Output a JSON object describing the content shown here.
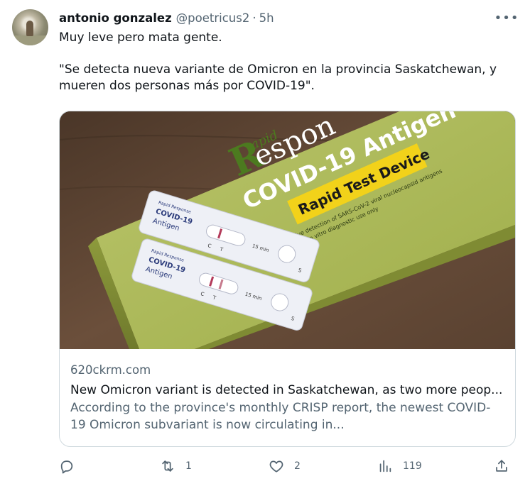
{
  "tweet": {
    "author_name": "antonio gonzalez",
    "handle": "@poetricus2",
    "separator": "·",
    "time": "5h",
    "more_label": "•••",
    "text_line1": "Muy leve pero mata gente.",
    "text_line2": "\"Se detecta nueva variante de Omicron en la provincia Saskatchewan, y mueren dos personas más por COVID-19\"."
  },
  "card": {
    "image_text": {
      "brand_r": "R",
      "brand_apid": "apid",
      "brand_respon": "espon",
      "antigen": "COVID-19 Antigen",
      "device": "Rapid Test Device",
      "fine_print_1": "Qualitative detection of SARS-CoV-2 viral nucleocapsid antigens",
      "fine_print_2": "For in vitro diagnostic use only",
      "cassette_brand": "Rapid Response",
      "cassette_label_1": "COVID-19",
      "cassette_label_2": "Antigen",
      "cassette_c": "C",
      "cassette_t": "T",
      "cassette_time": "15 min",
      "cassette_s": "S"
    },
    "domain": "620ckrm.com",
    "title": "New Omicron variant is detected in Saskatchewan, as two more peop...",
    "description": "According to the province's monthly CRISP report, the newest COVID-19 Omicron subvariant is now circulating in..."
  },
  "actions": {
    "reply_count": "",
    "retweet_count": "1",
    "like_count": "2",
    "views_count": "119",
    "icons": [
      "reply-icon",
      "retweet-icon",
      "like-icon",
      "views-icon",
      "share-icon"
    ]
  }
}
